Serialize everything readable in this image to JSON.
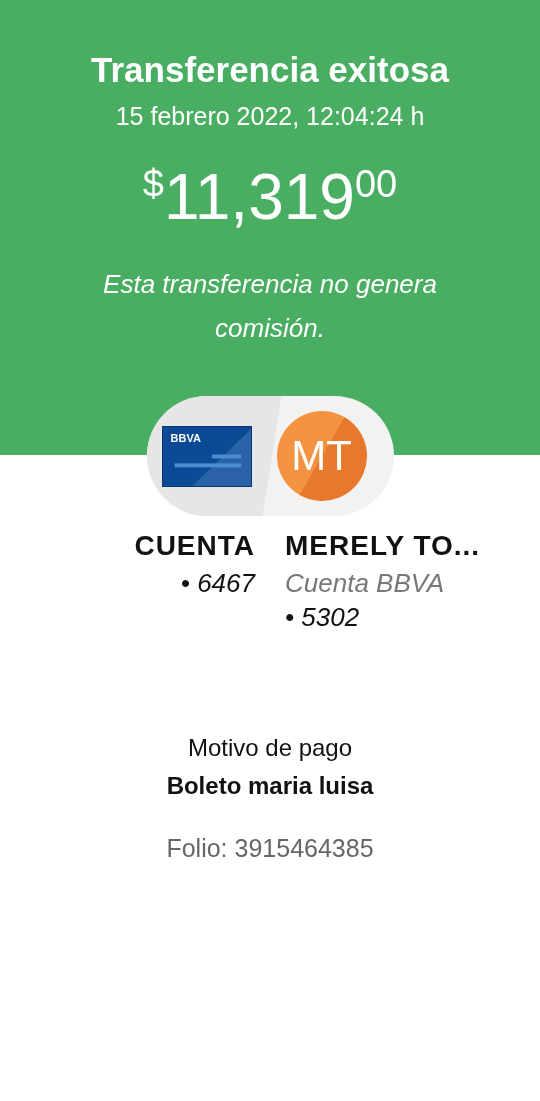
{
  "header": {
    "title": "Transferencia exitosa",
    "datetime": "15 febrero 2022, 12:04:24 h",
    "amount": {
      "currency": "$",
      "whole": "11,319",
      "cents": "00"
    },
    "note": "Esta transferencia no genera comisión."
  },
  "origin": {
    "card_label": "BBVA",
    "name": "CUENTA",
    "lines": [
      "• 6467"
    ]
  },
  "destination": {
    "initials": "MT",
    "name": "MERELY TO...",
    "lines": [
      "Cuenta BBVA",
      "• 5302"
    ]
  },
  "reason": {
    "label": "Motivo de pago",
    "value": "Boleto maria luisa"
  },
  "folio": "Folio: 3915464385"
}
